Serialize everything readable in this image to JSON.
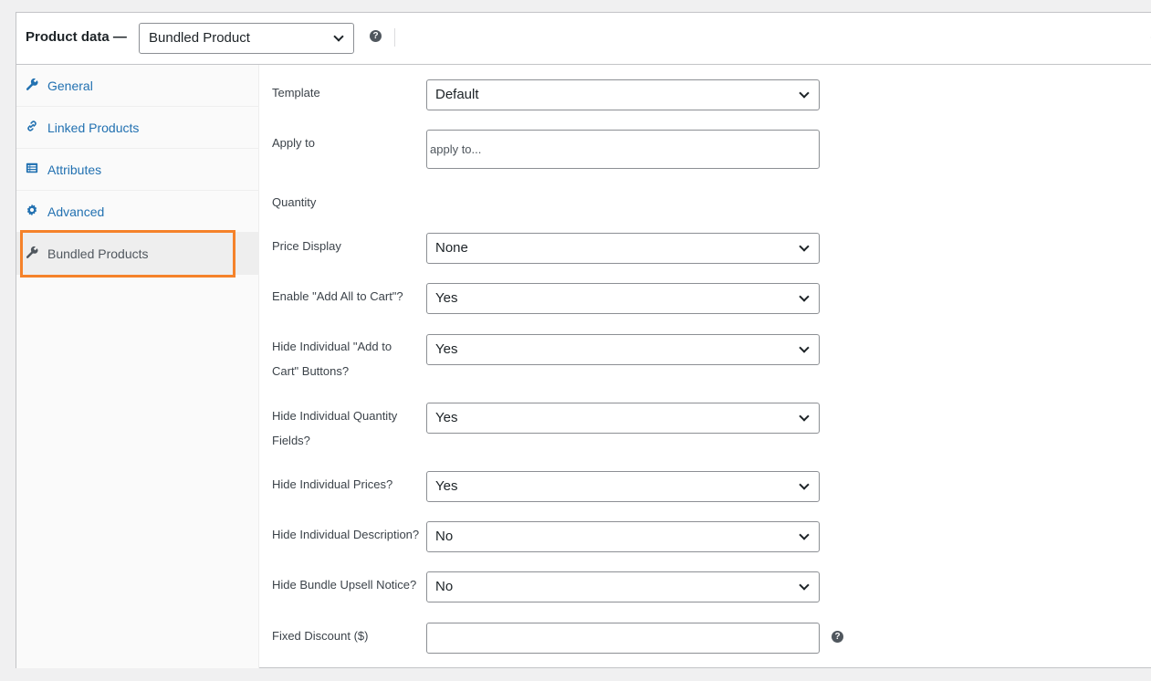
{
  "header": {
    "title": "Product data —",
    "product_type": "Bundled Product",
    "help_icon": "help-icon"
  },
  "sidebar": {
    "tabs": [
      {
        "label": "General",
        "icon": "wrench-icon",
        "active": false
      },
      {
        "label": "Linked Products",
        "icon": "link-icon",
        "active": false
      },
      {
        "label": "Attributes",
        "icon": "list-icon",
        "active": false
      },
      {
        "label": "Advanced",
        "icon": "gear-icon",
        "active": false
      },
      {
        "label": "Bundled Products",
        "icon": "wrench-icon",
        "active": true
      }
    ]
  },
  "form": {
    "template": {
      "label": "Template",
      "value": "Default"
    },
    "apply_to": {
      "label": "Apply to",
      "placeholder": "apply to..."
    },
    "quantity": {
      "label": "Quantity"
    },
    "price_display": {
      "label": "Price Display",
      "value": "None"
    },
    "enable_add_all": {
      "label": "Enable \"Add All to Cart\"?",
      "value": "Yes"
    },
    "hide_add_to_cart": {
      "label_line1": "Hide Individual \"Add to",
      "label_line2": "Cart\" Buttons?",
      "value": "Yes"
    },
    "hide_quantity": {
      "label_line1": "Hide Individual Quantity",
      "label_line2": "Fields?",
      "value": "Yes"
    },
    "hide_prices": {
      "label": "Hide Individual Prices?",
      "value": "Yes"
    },
    "hide_description": {
      "label": "Hide Individual Description?",
      "value": "No"
    },
    "hide_upsell": {
      "label": "Hide Bundle Upsell Notice?",
      "value": "No"
    },
    "fixed_discount": {
      "label": "Fixed Discount ($)",
      "value": ""
    }
  },
  "colors": {
    "link": "#2271b1",
    "highlight": "#f5822a",
    "text": "#1d2327"
  }
}
